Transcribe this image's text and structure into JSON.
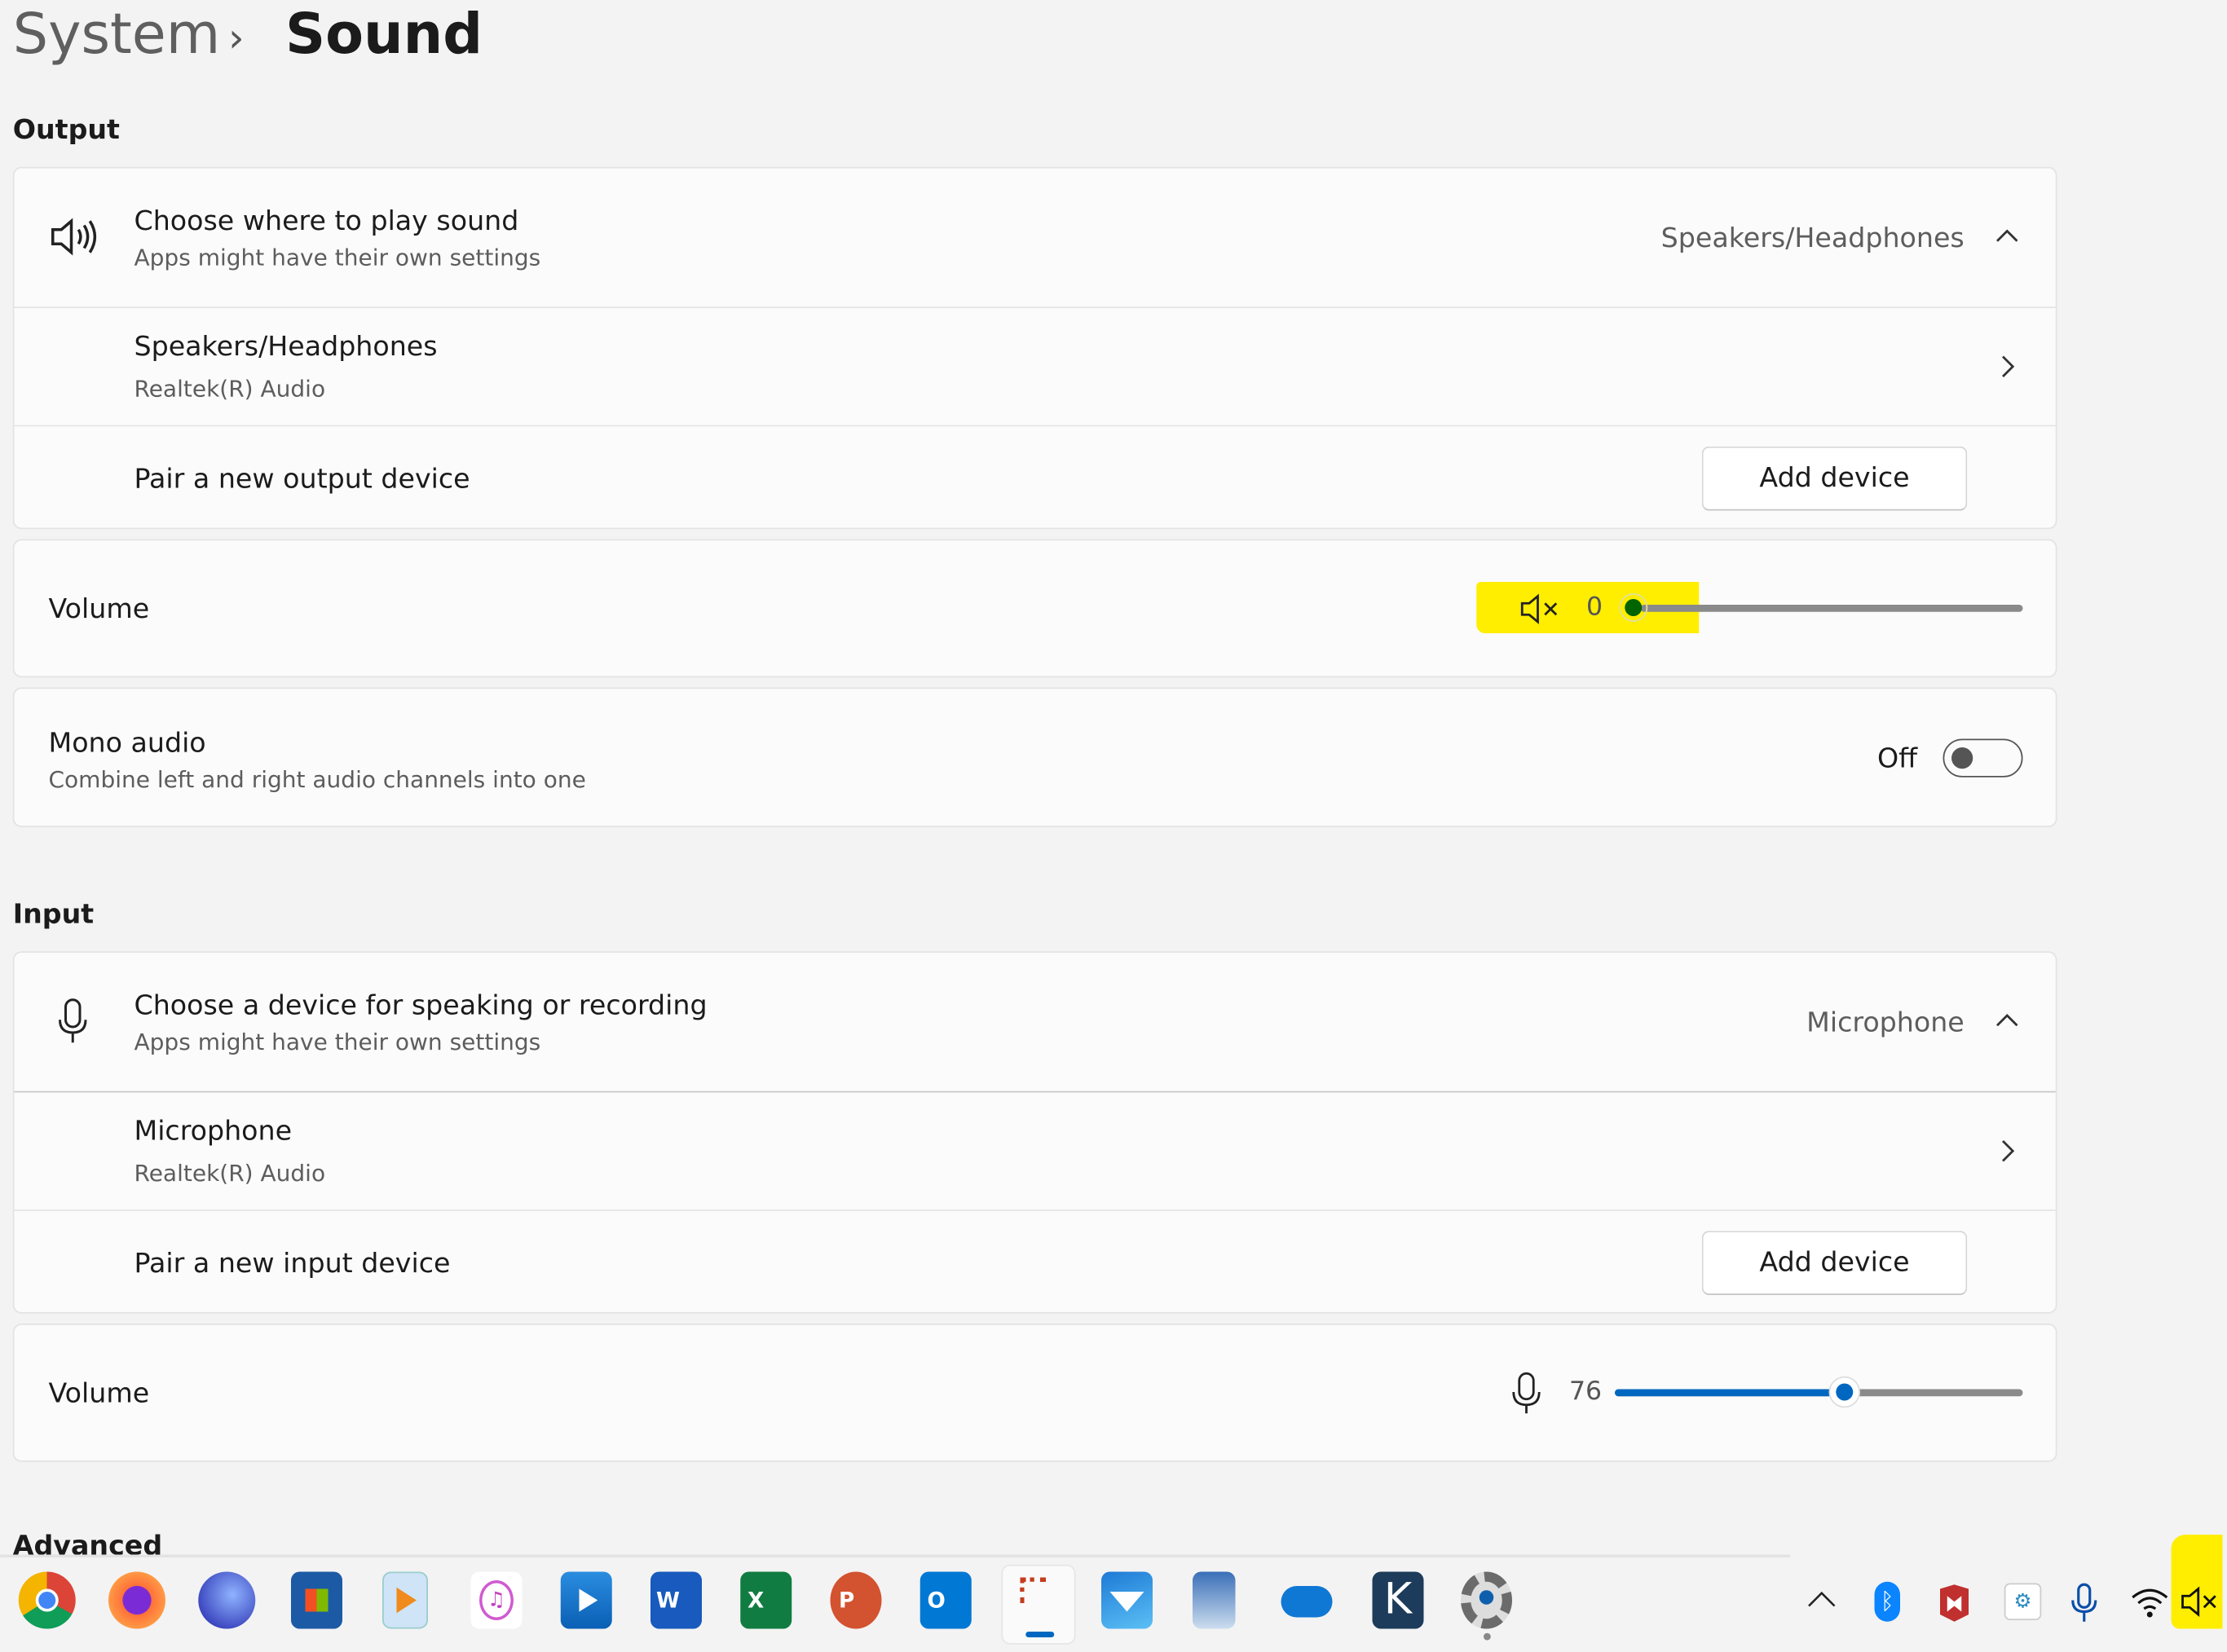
{
  "breadcrumb": {
    "parent": "System",
    "separator": "›",
    "current": "Sound"
  },
  "output": {
    "section_title": "Output",
    "choose": {
      "title": "Choose where to play sound",
      "subtitle": "Apps might have their own settings",
      "selected": "Speakers/Headphones",
      "icon": "speaker-icon"
    },
    "device": {
      "name": "Speakers/Headphones",
      "driver": "Realtek(R) Audio"
    },
    "pair": {
      "label": "Pair a new output device",
      "button": "Add device"
    },
    "volume": {
      "label": "Volume",
      "value": "0",
      "level": 0,
      "muted": true,
      "icon": "speaker-muted-icon",
      "thumb_color": "#006400",
      "highlight_color": "#ffee00"
    },
    "mono": {
      "title": "Mono audio",
      "subtitle": "Combine left and right audio channels into one",
      "state": "Off",
      "on": false
    }
  },
  "input": {
    "section_title": "Input",
    "choose": {
      "title": "Choose a device for speaking or recording",
      "subtitle": "Apps might have their own settings",
      "selected": "Microphone",
      "icon": "microphone-icon"
    },
    "device": {
      "name": "Microphone",
      "driver": "Realtek(R) Audio"
    },
    "pair": {
      "label": "Pair a new input device",
      "button": "Add device"
    },
    "volume": {
      "label": "Volume",
      "value": "76",
      "level": 76,
      "icon": "microphone-icon",
      "accent": "#0067c0"
    }
  },
  "advanced": {
    "section_title": "Advanced"
  },
  "taskbar": {
    "apps": [
      "chrome",
      "firefox",
      "browser",
      "microsoft-store",
      "media-player",
      "itunes",
      "movies-tv",
      "word",
      "excel",
      "powerpoint",
      "outlook",
      "snipping-tool",
      "mail",
      "paint",
      "onedrive",
      "k-app",
      "settings"
    ],
    "active_app": "snipping-tool",
    "tray": [
      "show-hidden-icons",
      "bluetooth",
      "mcafee",
      "brain-app",
      "microphone",
      "wifi",
      "volume-muted"
    ]
  }
}
